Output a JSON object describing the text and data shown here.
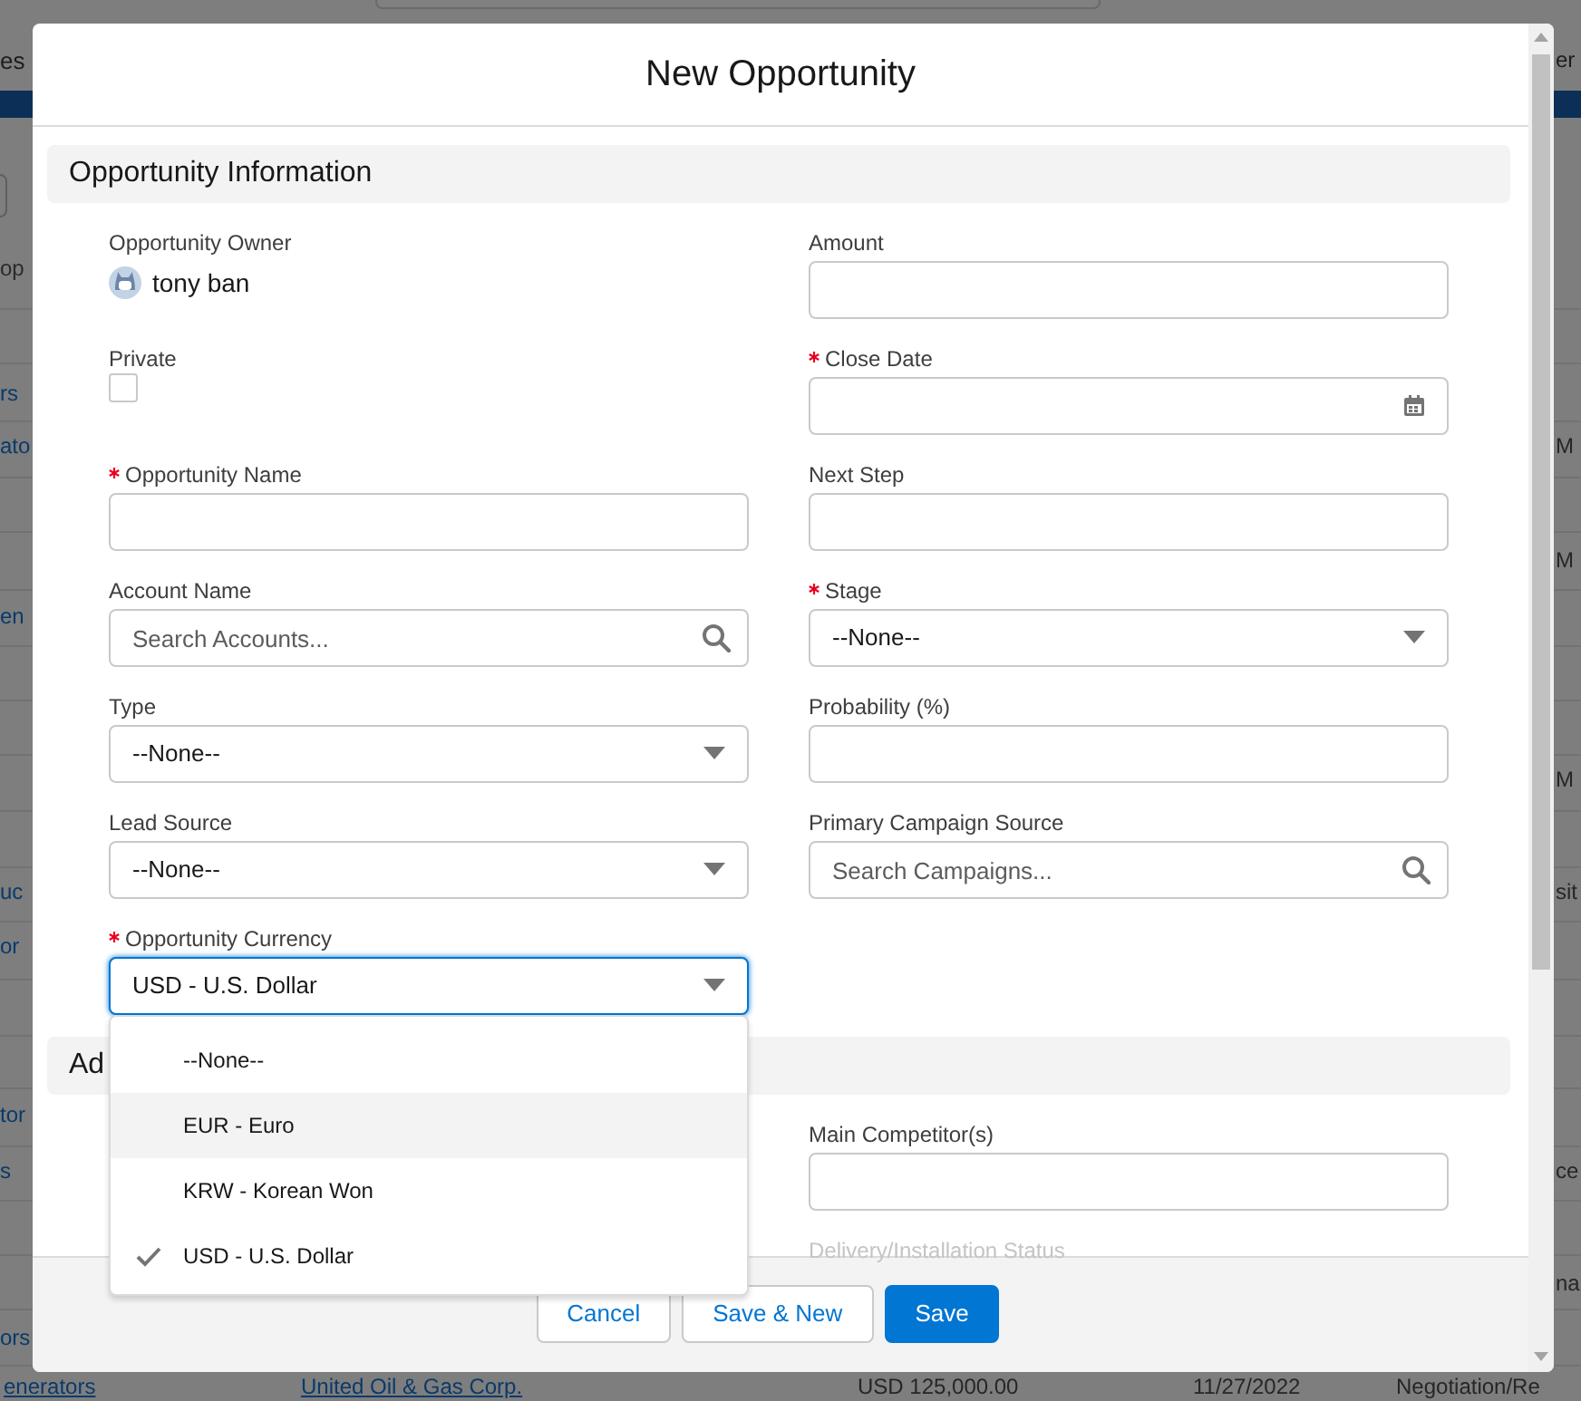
{
  "background_page": {
    "tab_left": "es",
    "tab_right": "er",
    "list_label": "op",
    "rows": [
      {
        "left": "rs"
      },
      {
        "left": "ato",
        "right": "M"
      },
      {
        "right": "M"
      },
      {
        "left": "en"
      },
      {
        "right": "M"
      },
      {
        "left": "uc",
        "right": "sit"
      },
      {
        "left": "or"
      },
      {
        "left": "tor"
      },
      {
        "left": "s",
        "right": "ce"
      },
      {
        "right": "na"
      },
      {
        "left": "ors"
      }
    ],
    "last_row": [
      {
        "text": "enerators",
        "kind": "link"
      },
      {
        "text": "United Oil & Gas Corp.",
        "kind": "link"
      },
      {
        "text": "USD 125,000.00",
        "kind": "plain"
      },
      {
        "text": "11/27/2022",
        "kind": "plain"
      },
      {
        "text": "Negotiation/Re",
        "kind": "plain"
      }
    ]
  },
  "modal": {
    "title": "New Opportunity",
    "sections": [
      {
        "title": "Opportunity Information",
        "rows": [
          {
            "left": {
              "kind": "owner",
              "label": "Opportunity Owner",
              "value": "tony ban"
            },
            "right": {
              "kind": "text",
              "label": "Amount"
            }
          },
          {
            "left": {
              "kind": "checkbox",
              "label": "Private",
              "checked": false
            },
            "right": {
              "kind": "date",
              "label": "Close Date",
              "required": true
            }
          },
          {
            "left": {
              "kind": "text",
              "label": "Opportunity Name",
              "required": true
            },
            "right": {
              "kind": "text",
              "label": "Next Step"
            }
          },
          {
            "left": {
              "kind": "lookup",
              "label": "Account Name",
              "placeholder": "Search Accounts..."
            },
            "right": {
              "kind": "select",
              "label": "Stage",
              "value": "--None--",
              "required": true
            }
          },
          {
            "left": {
              "kind": "select",
              "label": "Type",
              "value": "--None--"
            },
            "right": {
              "kind": "text",
              "label": "Probability (%)"
            }
          },
          {
            "left": {
              "kind": "select",
              "label": "Lead Source",
              "value": "--None--"
            },
            "right": {
              "kind": "lookup",
              "label": "Primary Campaign Source",
              "placeholder": "Search Campaigns..."
            }
          },
          {
            "left": {
              "kind": "select",
              "label": "Opportunity Currency",
              "value": "USD - U.S. Dollar",
              "required": true,
              "focused": true,
              "open": true
            }
          }
        ]
      },
      {
        "title": "Ad",
        "rows": [
          {
            "right": {
              "kind": "text",
              "label": "Main Competitor(s)"
            }
          },
          {
            "right": {
              "kind": "covered",
              "label": "Delivery/Installation Status"
            }
          }
        ]
      }
    ],
    "currency_menu": [
      {
        "label": "--None--",
        "selected": false,
        "highlighted": false
      },
      {
        "label": "EUR - Euro",
        "selected": false,
        "highlighted": true
      },
      {
        "label": "KRW - Korean Won",
        "selected": false,
        "highlighted": false
      },
      {
        "label": "USD - U.S. Dollar",
        "selected": true,
        "highlighted": false
      }
    ],
    "buttons": [
      {
        "label": "Cancel",
        "kind": "neutral"
      },
      {
        "label": "Save & New",
        "kind": "neutral"
      },
      {
        "label": "Save",
        "kind": "brand"
      }
    ]
  }
}
